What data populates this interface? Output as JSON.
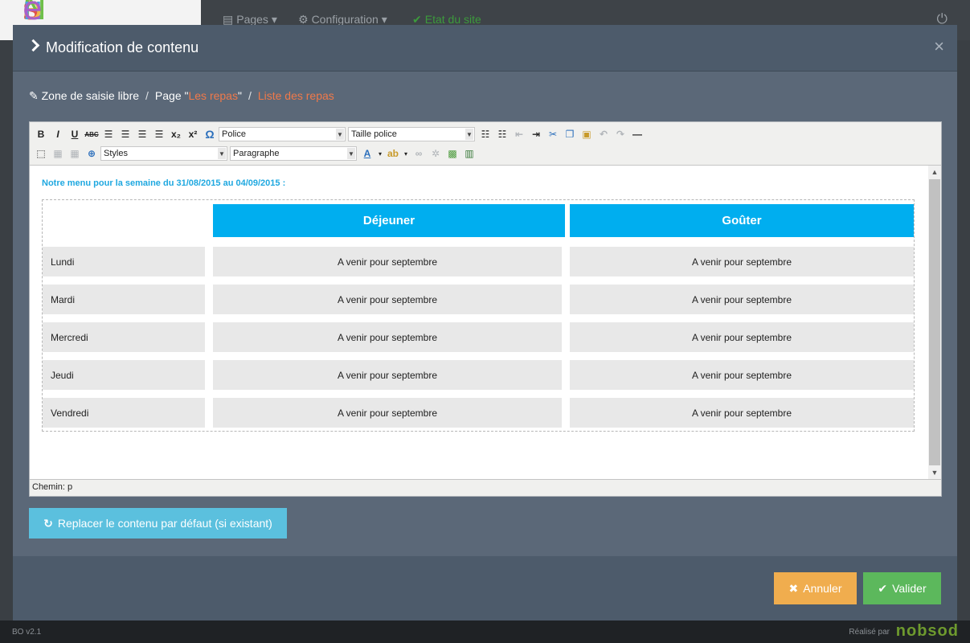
{
  "background": {
    "logo_text": "La Nursorie",
    "nav": [
      {
        "icon": "file-icon",
        "label": "Pages"
      },
      {
        "icon": "gear-icon",
        "label": "Configuration"
      },
      {
        "icon": "check-circle-icon",
        "label": "Etat du site"
      }
    ],
    "footer_version": "BO v2.1",
    "footer_made_by": "Réalisé par",
    "footer_brand": "nobsod"
  },
  "modal": {
    "title": "Modification de contenu",
    "close_symbol": "×",
    "breadcrumb": {
      "zone": "Zone de saisie libre",
      "page_prefix": "Page \"",
      "page_name": "Les repas",
      "page_suffix": "\"",
      "separator": "/",
      "current": "Liste des repas"
    },
    "toolbar": {
      "font_select": "Police",
      "size_select": "Taille police",
      "styles_select": "Styles",
      "format_select": "Paragraphe"
    },
    "content": {
      "heading": "Notre menu pour la semaine du 31/08/2015 au 04/09/2015 :",
      "columns": [
        "Déjeuner",
        "Goûter"
      ],
      "rows": [
        {
          "day": "Lundi",
          "dejeuner": "A venir pour septembre",
          "gouter": "A venir pour septembre"
        },
        {
          "day": "Mardi",
          "dejeuner": "A venir pour septembre",
          "gouter": "A venir pour septembre"
        },
        {
          "day": "Mercredi",
          "dejeuner": "A venir pour septembre",
          "gouter": "A venir pour septembre"
        },
        {
          "day": "Jeudi",
          "dejeuner": "A venir pour septembre",
          "gouter": "A venir pour septembre"
        },
        {
          "day": "Vendredi",
          "dejeuner": "A venir pour septembre",
          "gouter": "A venir pour septembre"
        }
      ]
    },
    "statusbar": "Chemin: p",
    "reset_button": "Replacer le contenu par défaut (si existant)",
    "cancel_button": "Annuler",
    "validate_button": "Valider"
  },
  "colors": {
    "accent_blue": "#00aeef",
    "breadcrumb_highlight": "#f0794a",
    "cancel": "#f0ad4e",
    "validate": "#5cb85c",
    "reset": "#5bc0de"
  }
}
